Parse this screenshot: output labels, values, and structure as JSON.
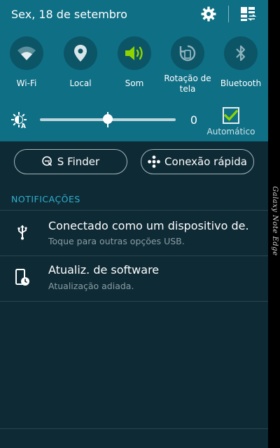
{
  "status": {
    "date": "Sex, 18 de setembro"
  },
  "quick_toggles": [
    {
      "label": "Wi-Fi",
      "icon": "wifi-icon",
      "active": false
    },
    {
      "label": "Local",
      "icon": "location-icon",
      "active": false
    },
    {
      "label": "Som",
      "icon": "sound-icon",
      "active": true
    },
    {
      "label": "Rotação de tela",
      "icon": "rotation-icon",
      "active": false
    },
    {
      "label": "Bluetooth",
      "icon": "bluetooth-icon",
      "active": false
    }
  ],
  "brightness": {
    "value": "0",
    "level_fraction": 0.5,
    "auto_label": "Automático",
    "auto_checked": true
  },
  "buttons": {
    "sfinder": "S Finder",
    "quick_connect": "Conexão rápida"
  },
  "notifications": {
    "header": "NOTIFICAÇÕES",
    "items": [
      {
        "title": "Conectado como um dispositivo de.",
        "subtitle": "Toque para outras opções USB.",
        "icon": "usb-icon"
      },
      {
        "title": "Atualiz. de software",
        "subtitle": "Atualização adiada.",
        "icon": "software-update-icon"
      }
    ]
  },
  "edge_label": "Galaxy Note Edge",
  "colors": {
    "accent": "#2eb1cf",
    "quick_panel": "#0f6f85",
    "active_icon": "#8fd400",
    "background": "#0e2a35"
  }
}
